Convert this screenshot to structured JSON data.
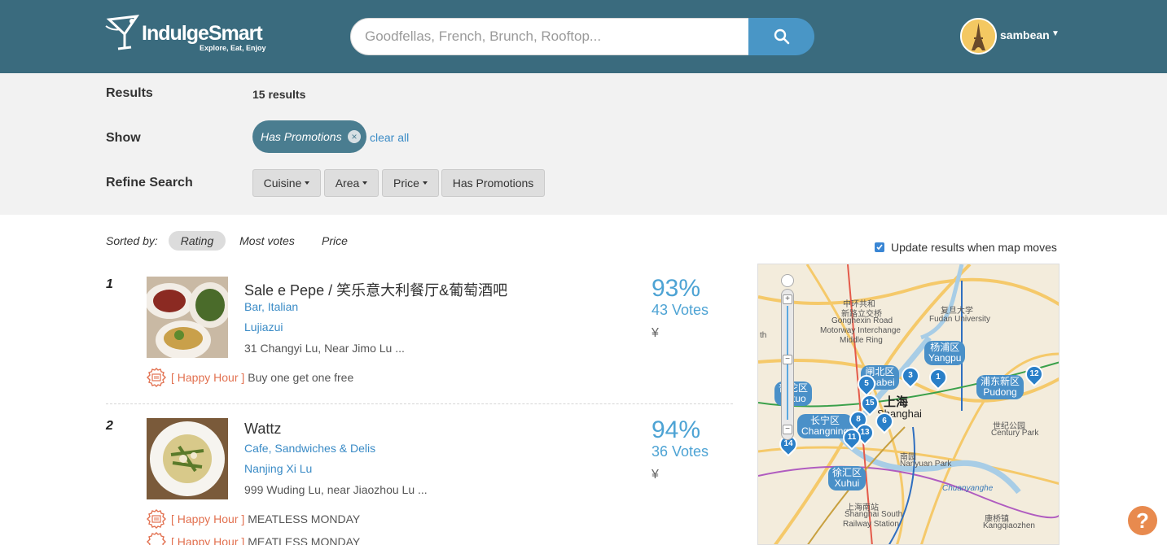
{
  "header": {
    "logo_title": "IndulgeSmart",
    "logo_tagline": "Explore, Eat, Enjoy",
    "search_placeholder": "Goodfellas, French, Brunch, Rooftop...",
    "username": "sambean",
    "brand_color": "#3a6b7e",
    "search_button_color": "#4996c6"
  },
  "filters": {
    "results_label": "Results",
    "results_count": "15 results",
    "show_label": "Show",
    "active_chip": "Has Promotions",
    "clear_all": "clear all",
    "refine_label": "Refine Search",
    "refine_buttons": [
      "Cuisine",
      "Area",
      "Price",
      "Has Promotions"
    ]
  },
  "sort": {
    "label": "Sorted by:",
    "options": [
      "Rating",
      "Most votes",
      "Price"
    ],
    "active": "Rating"
  },
  "map_toggle": {
    "label": "Update results when map moves",
    "checked": true
  },
  "results": [
    {
      "rank": "1",
      "name": "Sale e Pepe / 笑乐意大利餐厅&葡萄酒吧",
      "cuisine": "Bar, Italian",
      "area": "Lujiazui",
      "address": "31 Changyi Lu, Near Jimo Lu ...",
      "promos": [
        {
          "tag": "[ Happy Hour ]",
          "text": "Buy one get one free"
        }
      ],
      "rating": "93%",
      "votes": "43 Votes",
      "price": "¥"
    },
    {
      "rank": "2",
      "name": "Wattz",
      "cuisine": "Cafe, Sandwiches & Delis",
      "area": "Nanjing Xi Lu",
      "address": "999 Wuding Lu, near Jiaozhou Lu ...",
      "promos": [
        {
          "tag": "[ Happy Hour ]",
          "text": "MEATLESS MONDAY"
        },
        {
          "tag": "[ Happy Hour ]",
          "text": "MEATLESS MONDAY"
        }
      ],
      "rating": "94%",
      "votes": "36 Votes",
      "price": "¥"
    }
  ],
  "map": {
    "labels": [
      "中环共和",
      "新路立交桥",
      "Gonghexin Road",
      "Motorway Interchange",
      "Middle Ring",
      "复旦大学",
      "Fudan University",
      "世纪公园",
      "Century Park",
      "南园",
      "Nanyuan Park",
      "上海南站",
      "Shanghai South",
      "Railway Station",
      "康桥镇",
      "Kangqiaozhen",
      "Chuanyanghe",
      "上海",
      "Shanghai",
      "th"
    ],
    "districts": [
      "杨浦区",
      "Yangpu",
      "闸北区",
      "Zhabei",
      "普陀区",
      "Putuo",
      "长宁区",
      "Changning",
      "浦东新区",
      "Pudong",
      "徐汇区",
      "Xuhui"
    ],
    "pins": [
      "1",
      "3",
      "5",
      "15",
      "8",
      "6",
      "13",
      "11",
      "12",
      "14"
    ]
  },
  "help_label": "?"
}
